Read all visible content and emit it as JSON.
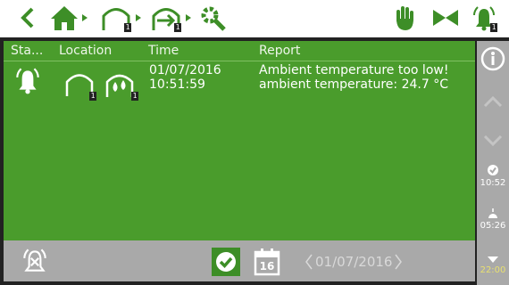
{
  "table": {
    "headers": [
      "Sta...",
      "Location",
      "Time",
      "Report"
    ],
    "rows": [
      {
        "status_icon": "alarm-bell-icon",
        "location_icons": [
          "greenhouse-icon",
          "humidity-sensor-icon"
        ],
        "location_badges": [
          "1",
          "1"
        ],
        "date": "01/07/2016",
        "time": "10:51:59",
        "report_line1": "Ambient temperature too low!",
        "report_line2": "ambient temperature: 24.7 °C"
      }
    ]
  },
  "topbar": {
    "greenhouse_badge": "1",
    "export_badge": "1",
    "alarm_badge": "1"
  },
  "sidebar": {
    "time_1": "10:52",
    "time_2": "05:26",
    "time_3": "22:00"
  },
  "bottom": {
    "date": "01/07/2016",
    "calendar_day": "16"
  },
  "colors": {
    "accent_green": "#4a9c2c",
    "dark_green": "#3d8e27",
    "side_gray": "#a9a9a9"
  }
}
